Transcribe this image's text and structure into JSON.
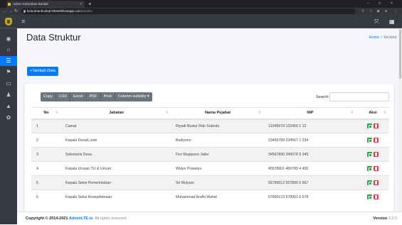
{
  "browser": {
    "tab_title": "Admin Kelurahan Bunkal",
    "tab_close": "×",
    "new_tab": "+",
    "url_host": "kelurahanbunkal.000webhostapp.com",
    "url_path": "/struktur",
    "win_min": "–",
    "win_max": "□",
    "win_close": "×"
  },
  "navbar": {
    "burger": "≡",
    "right_1": "⤧",
    "right_2": "▦"
  },
  "page": {
    "title": "Data Struktur",
    "breadcrumb_home": "Home",
    "breadcrumb_sep": "/",
    "breadcrumb_current": "Struktur",
    "add_button": "+Tambah Data"
  },
  "datatable": {
    "buttons": [
      "Copy",
      "CSV",
      "Excel",
      "PDF",
      "Print",
      "Column visibility ▾"
    ],
    "search_label": "Search:",
    "search_value": "",
    "columns": [
      "No",
      "Jabatan",
      "Nama Pejabat",
      "NIP",
      "Aksi"
    ],
    "rows": [
      {
        "no": "1",
        "jabatan": "Camat",
        "nama": "Riyadi Bustur Rdo Subroto",
        "nip": "12345678 123456 1 12"
      },
      {
        "no": "2",
        "jabatan": "Kepala Desa/Lurah",
        "nama": "Budiyono",
        "nip": "23456789 234567 2 234"
      },
      {
        "no": "3",
        "jabatan": "Sekretaris Desa",
        "nama": "Firo Mupiyono Jaiko",
        "nip": "34567890 345678 3 345"
      },
      {
        "no": "4",
        "jabatan": "Kepala Urusan TU & Umum",
        "nama": "Widyo Prasetyo",
        "nip": "45678901 456789 4 456"
      },
      {
        "no": "5",
        "jabatan": "Kepala Seksi Pemerintahan",
        "nama": "Sri Mulyani",
        "nip": "56789012 567890 5 567"
      },
      {
        "no": "6",
        "jabatan": "Kepala Seksi Kesejahteraan",
        "nama": "Muhammad Andhi Wahid",
        "nip": "67890123 678901 6 678"
      }
    ]
  },
  "footer": {
    "copyright_prefix": "Copyright © 2014-2021",
    "copyright_link": "AdminLTE.io",
    "copyright_suffix": ". All rights reserved.",
    "version_label": "Version",
    "version_value": "3.2.0"
  },
  "sidebar": {
    "icons": [
      "dashboard-icon",
      "bank-icon",
      "list-icon",
      "flag-icon",
      "image-icon",
      "user-icon",
      "lock-icon",
      "settings-icon"
    ]
  },
  "colors": {
    "sidebar_bg": "#343a40",
    "primary": "#007bff",
    "success": "#28a745",
    "danger": "#dc3545",
    "secondary": "#6c757d",
    "content_bg": "#f4f6f9"
  }
}
